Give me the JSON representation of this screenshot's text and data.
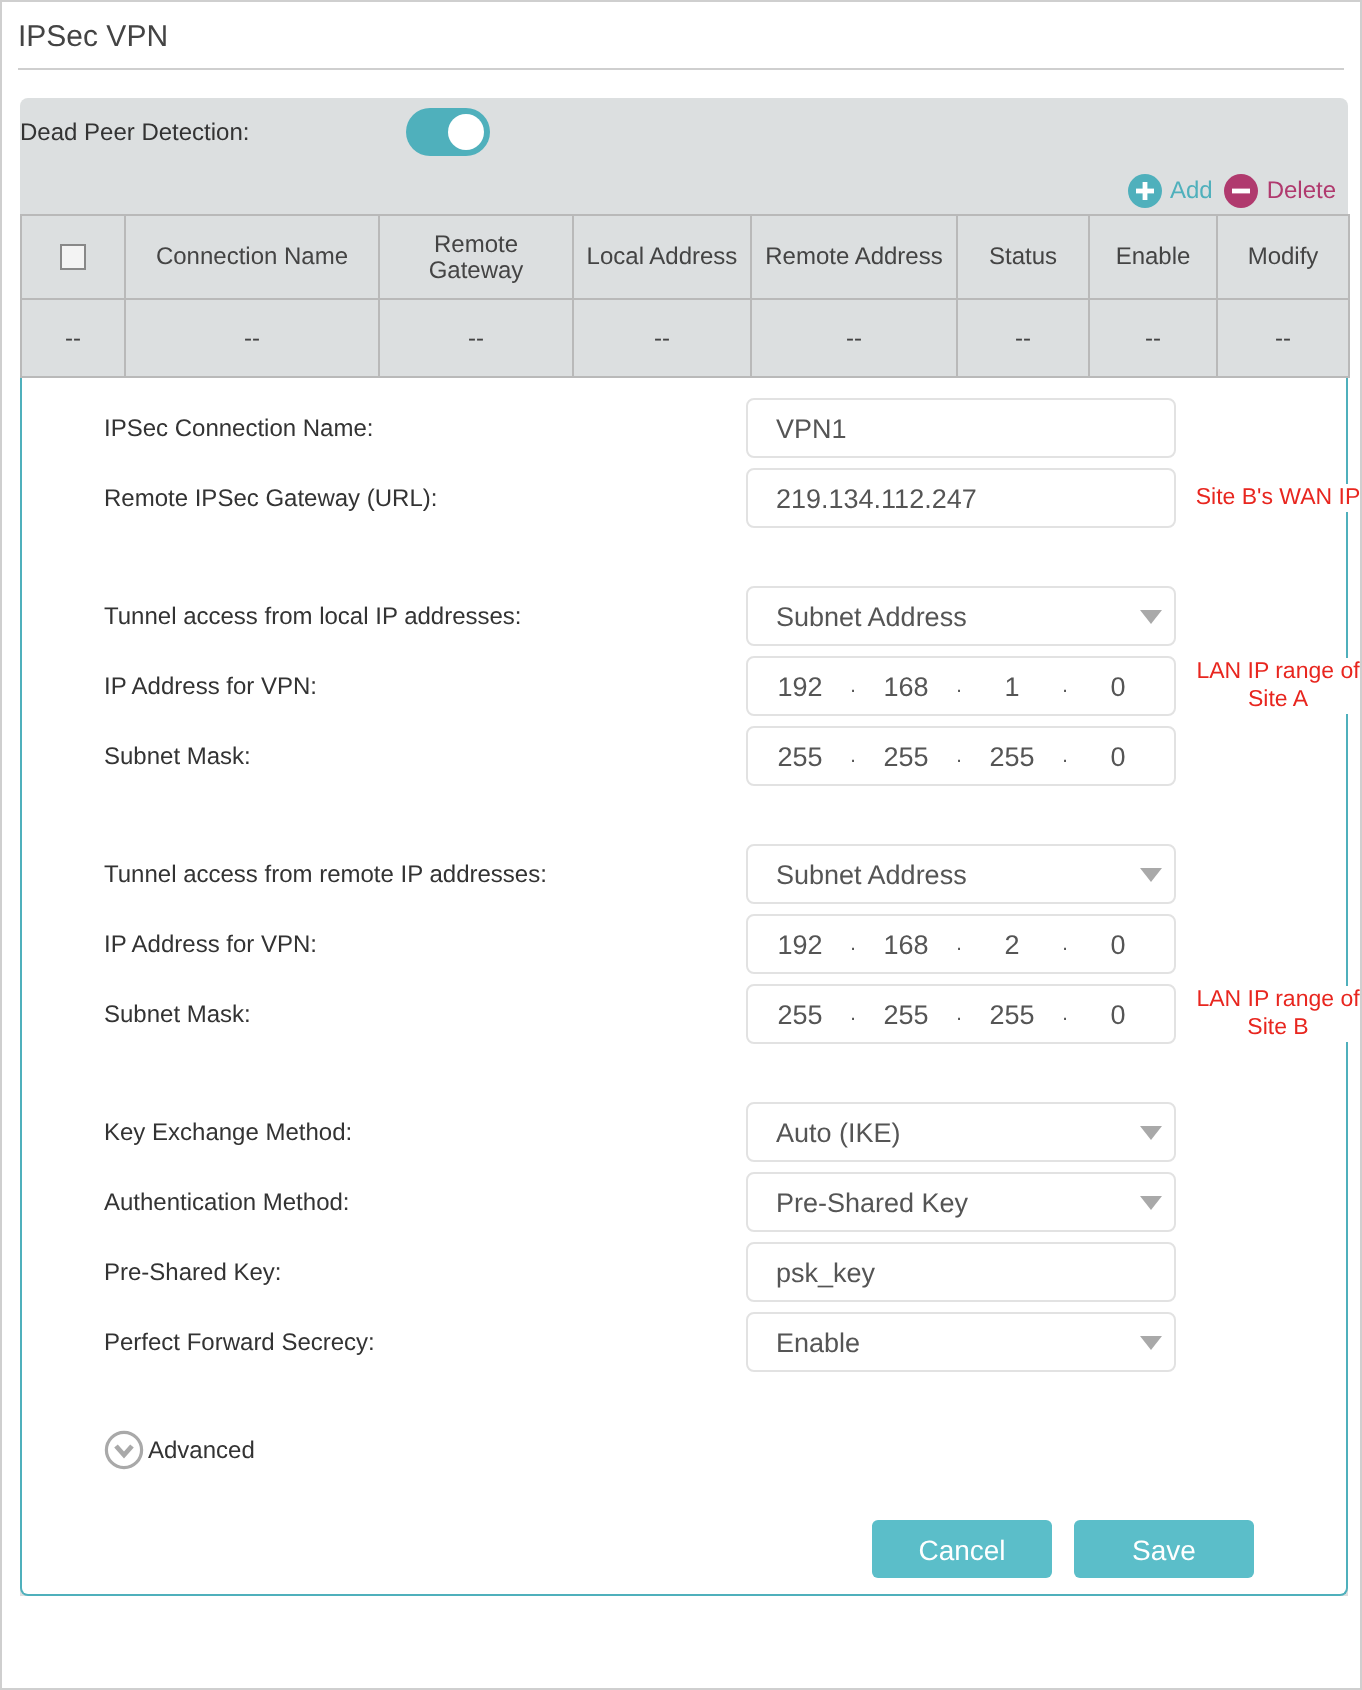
{
  "title": "IPSec VPN",
  "dead_peer_detection": {
    "label": "Dead Peer Detection:",
    "on": true
  },
  "actions": [
    {
      "kind": "add",
      "label": "Add"
    },
    {
      "kind": "delete",
      "label": "Delete"
    }
  ],
  "table": {
    "select_all": {
      "checked": false
    },
    "columns": [
      "",
      "Connection Name",
      "Remote Gateway",
      "Local Address",
      "Remote Address",
      "Status",
      "Enable",
      "Modify"
    ],
    "rows": [
      [
        "--",
        "--",
        "--",
        "--",
        "--",
        "--",
        "--",
        "--"
      ]
    ]
  },
  "form": {
    "ip_separator": ".",
    "sections": [
      [
        {
          "kind": "text",
          "label": "IPSec Connection Name:",
          "value": "VPN1"
        },
        {
          "kind": "text",
          "label": "Remote IPSec Gateway (URL):",
          "value": "219.134.112.247",
          "note": "Site B's WAN IP"
        }
      ],
      [
        {
          "kind": "select",
          "label": "Tunnel access from local IP addresses:",
          "value": "Subnet Address"
        },
        {
          "kind": "ip",
          "label": "IP Address for VPN:",
          "octets": [
            "192",
            "168",
            "1",
            "0"
          ],
          "note": "LAN IP range of Site A"
        },
        {
          "kind": "ip",
          "label": "Subnet Mask:",
          "octets": [
            "255",
            "255",
            "255",
            "0"
          ]
        }
      ],
      [
        {
          "kind": "select",
          "label": "Tunnel access from remote IP addresses:",
          "value": "Subnet Address"
        },
        {
          "kind": "ip",
          "label": "IP Address for VPN:",
          "octets": [
            "192",
            "168",
            "2",
            "0"
          ]
        },
        {
          "kind": "ip",
          "label": "Subnet Mask:",
          "octets": [
            "255",
            "255",
            "255",
            "0"
          ],
          "note": "LAN IP range of Site B"
        }
      ],
      [
        {
          "kind": "select",
          "label": "Key Exchange Method:",
          "value": "Auto (IKE)"
        },
        {
          "kind": "select",
          "label": "Authentication Method:",
          "value": "Pre-Shared Key"
        },
        {
          "kind": "text",
          "label": "Pre-Shared Key:",
          "value": "psk_key"
        },
        {
          "kind": "select",
          "label": "Perfect Forward Secrecy:",
          "value": "Enable"
        }
      ]
    ],
    "advanced": {
      "label": "Advanced",
      "expanded": false
    },
    "buttons": [
      "Cancel",
      "Save"
    ]
  }
}
